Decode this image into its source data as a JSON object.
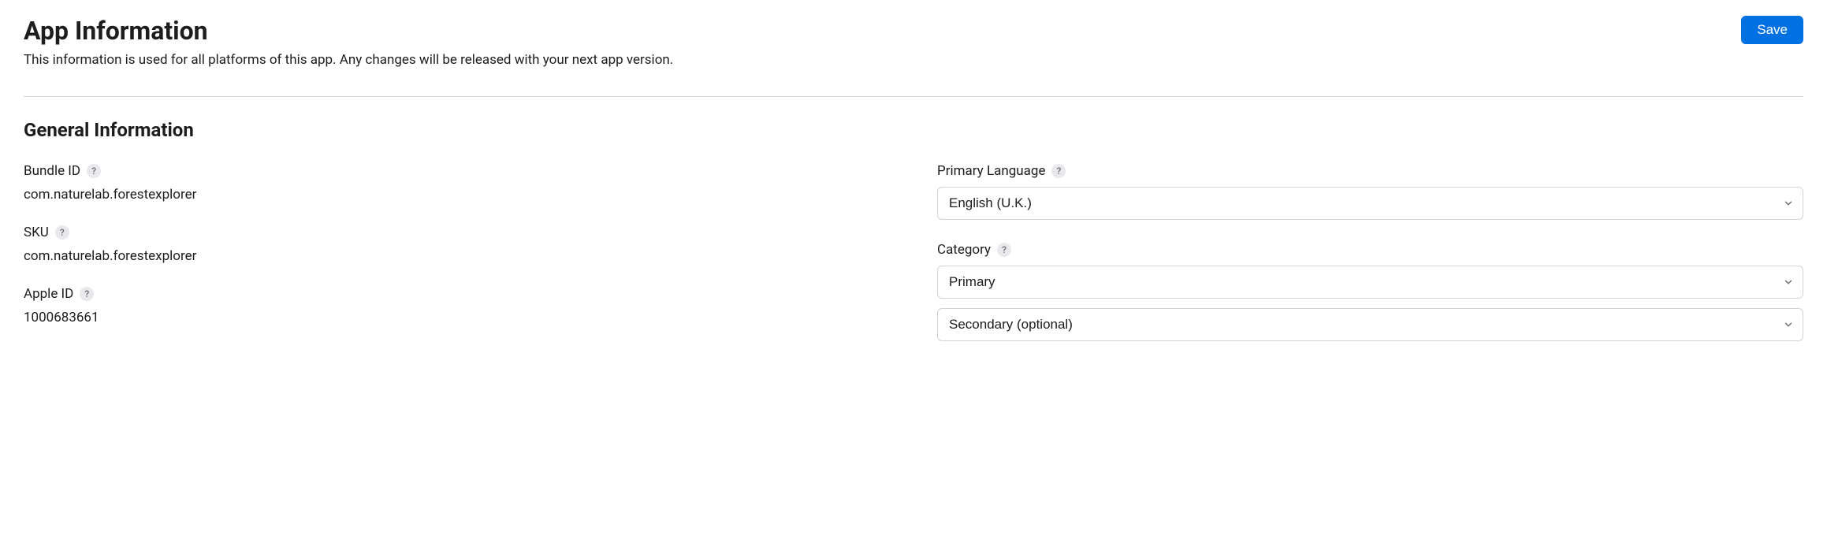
{
  "header": {
    "title": "App Information",
    "subtitle": "This information is used for all platforms of this app. Any changes will be released with your next app version.",
    "save_label": "Save"
  },
  "section": {
    "title": "General Information"
  },
  "left": {
    "bundle_id": {
      "label": "Bundle ID",
      "value": "com.naturelab.forestexplorer"
    },
    "sku": {
      "label": "SKU",
      "value": "com.naturelab.forestexplorer"
    },
    "apple_id": {
      "label": "Apple ID",
      "value": "1000683661"
    }
  },
  "right": {
    "primary_language": {
      "label": "Primary Language",
      "value": "English (U.K.)"
    },
    "category": {
      "label": "Category",
      "primary_value": "Primary",
      "secondary_value": "Secondary (optional)"
    }
  },
  "help_glyph": "?"
}
